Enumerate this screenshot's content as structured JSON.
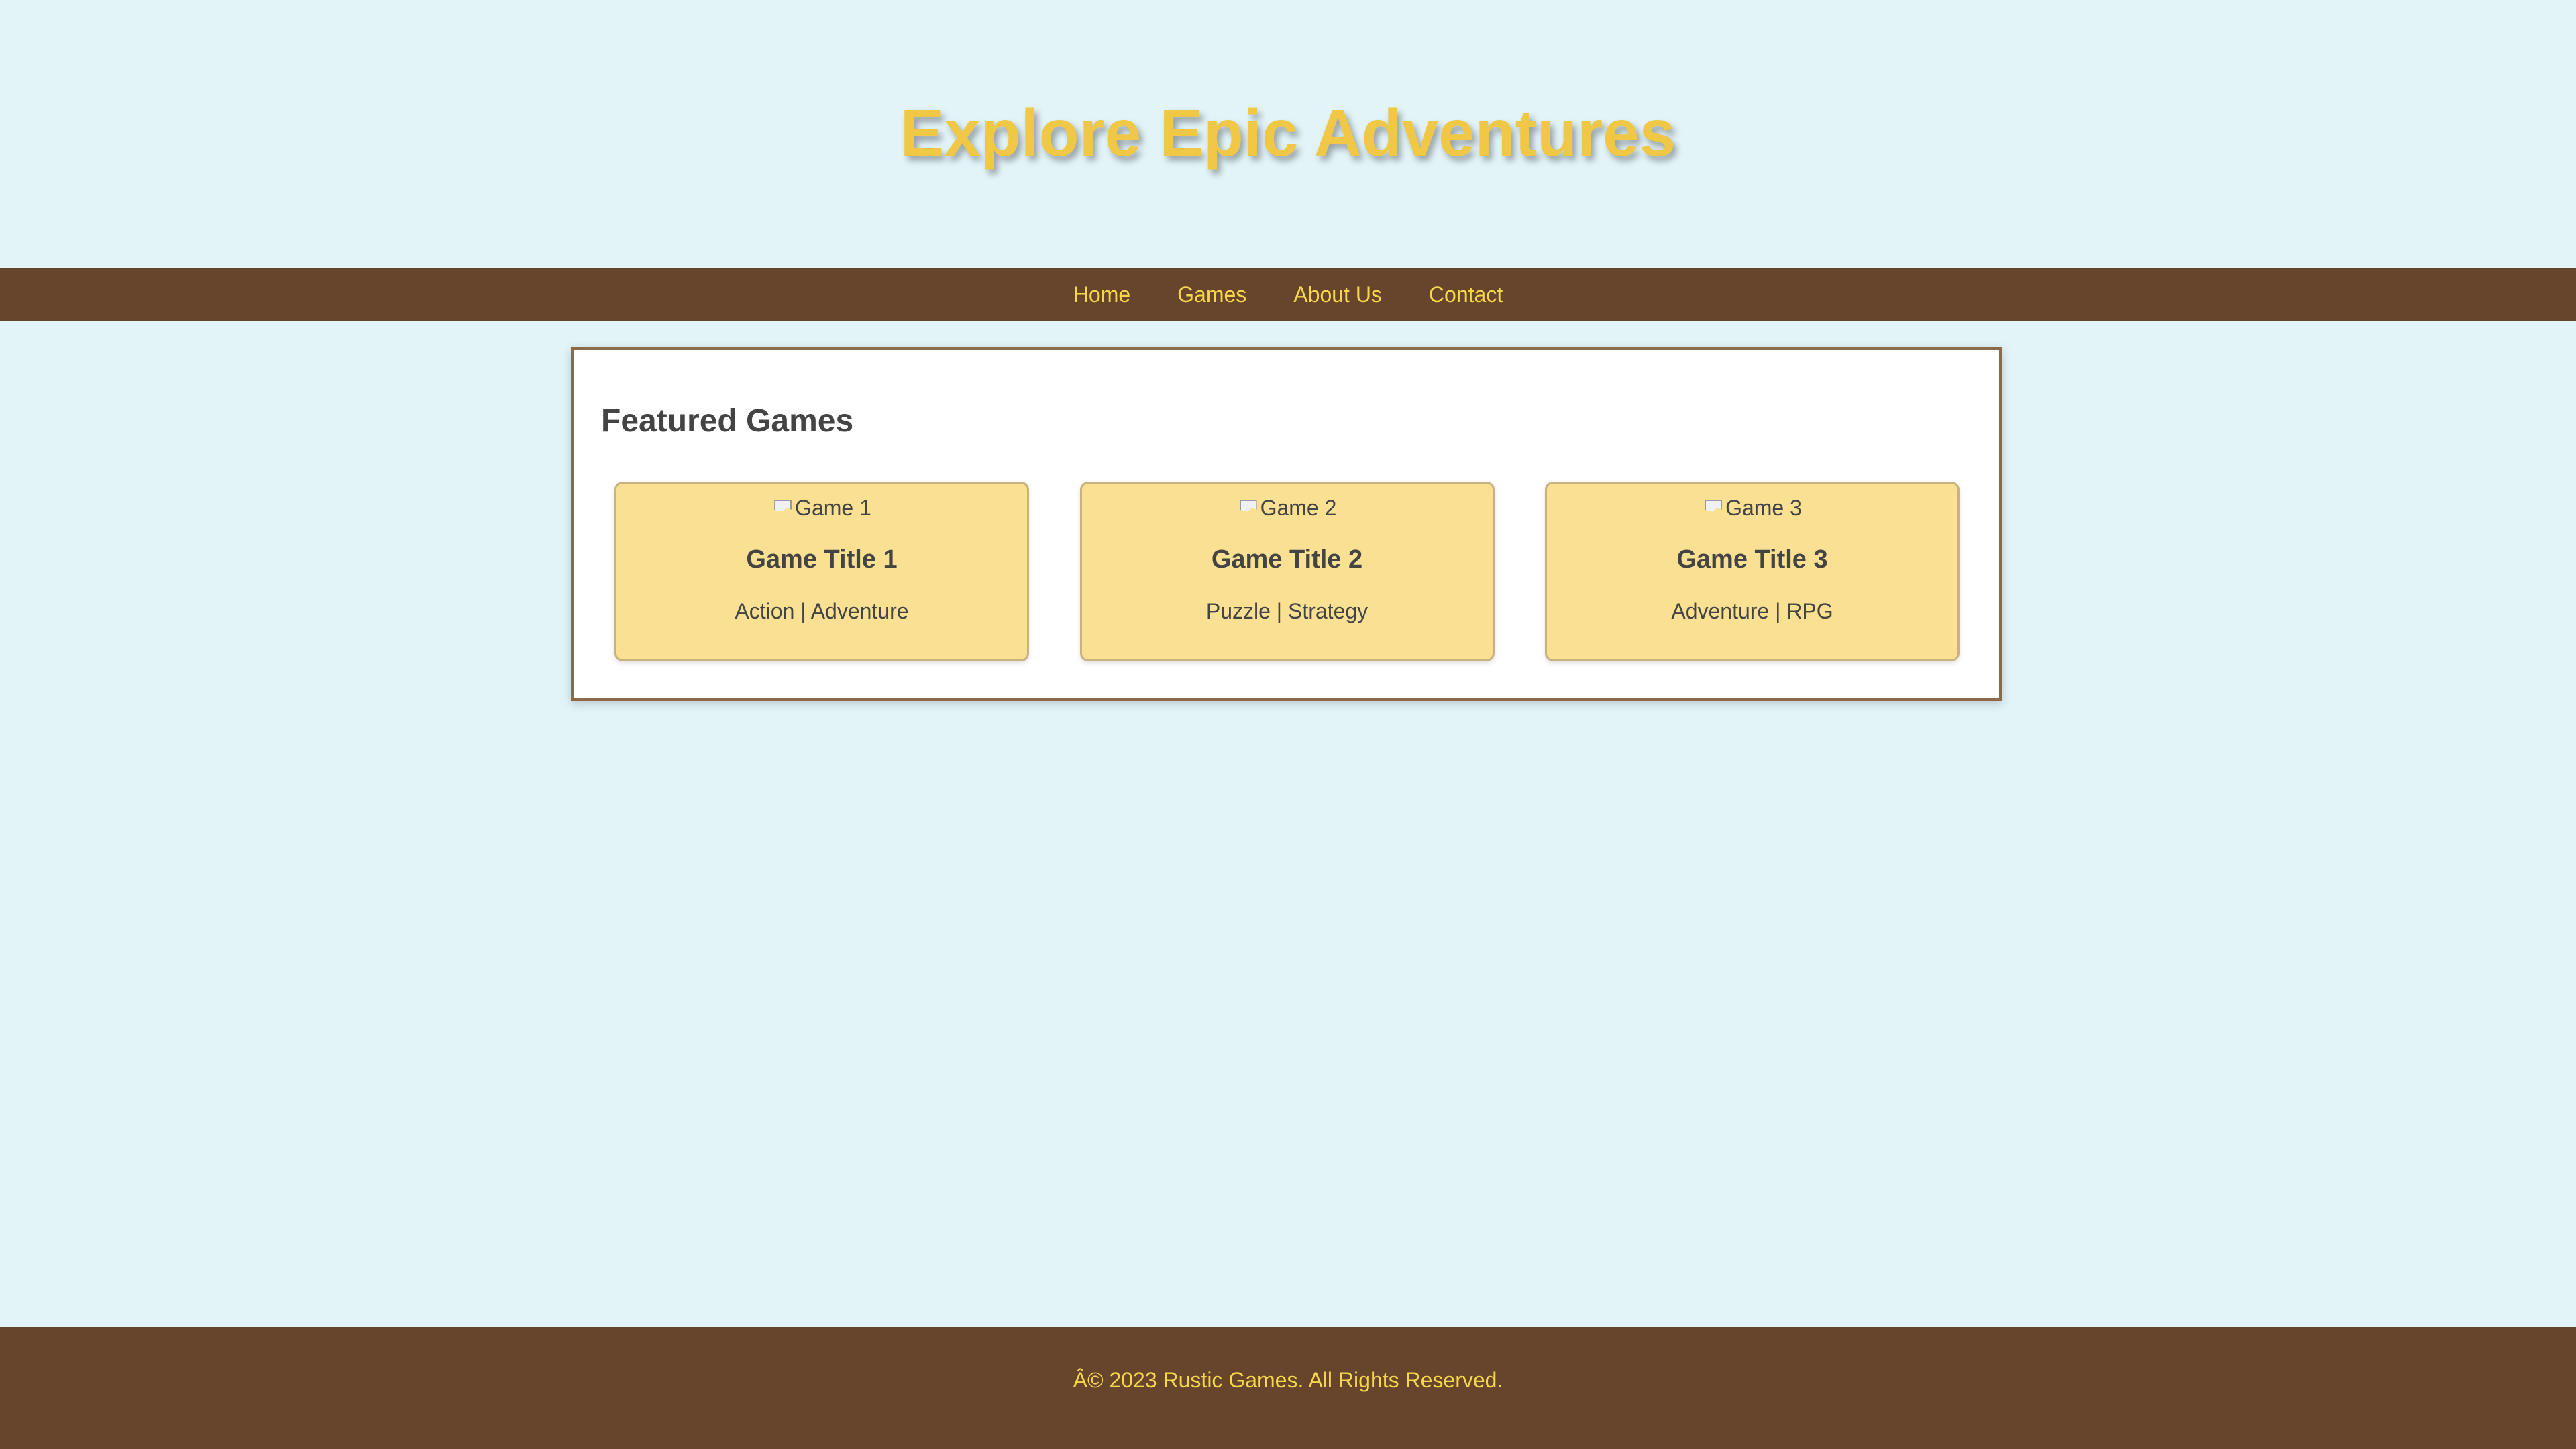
{
  "header": {
    "title": "Explore Epic Adventures"
  },
  "nav": {
    "items": [
      {
        "label": "Home"
      },
      {
        "label": "Games"
      },
      {
        "label": "About Us"
      },
      {
        "label": "Contact"
      }
    ]
  },
  "featured": {
    "title": "Featured Games",
    "games": [
      {
        "image_alt": "Game 1",
        "title": "Game Title 1",
        "genre": "Action | Adventure"
      },
      {
        "image_alt": "Game 2",
        "title": "Game Title 2",
        "genre": "Puzzle | Strategy"
      },
      {
        "image_alt": "Game 3",
        "title": "Game Title 3",
        "genre": "Adventure | RPG"
      }
    ]
  },
  "footer": {
    "text": "Â© 2023 Rustic Games. All Rights Reserved."
  },
  "colors": {
    "page_background": "#e2f4f8",
    "nav_footer_background": "#66452c",
    "accent_yellow": "#f0c846",
    "card_background": "#f9e092",
    "panel_border": "#8a6a49"
  }
}
